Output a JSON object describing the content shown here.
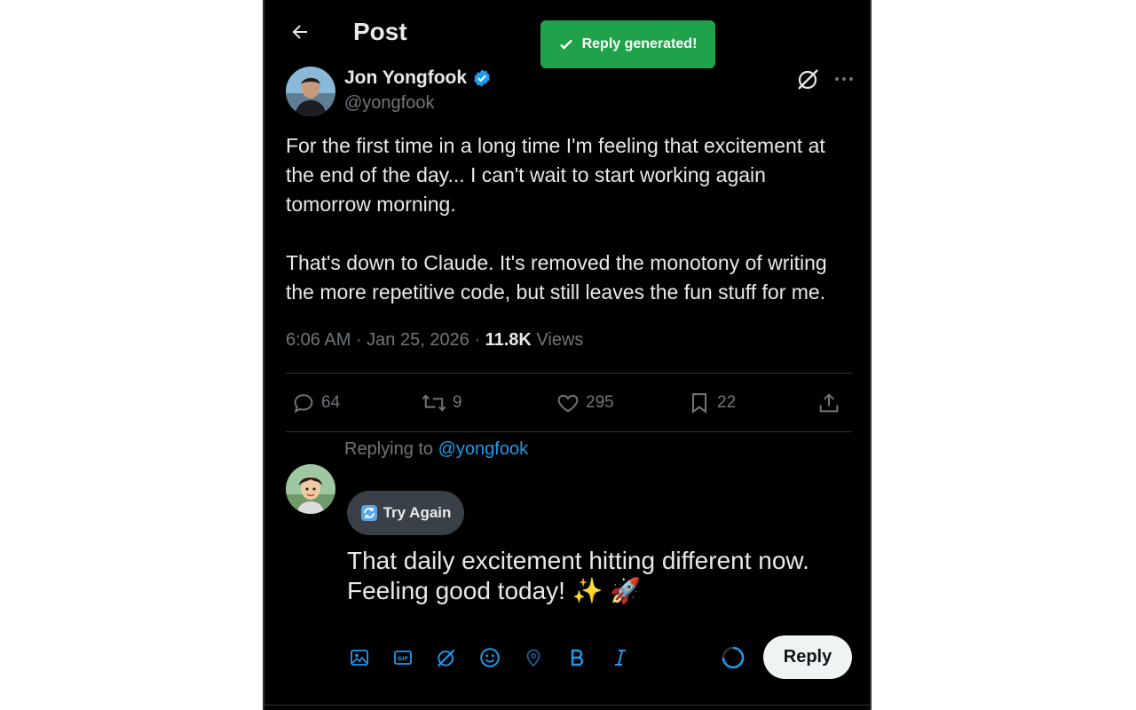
{
  "header": {
    "title": "Post",
    "back_icon": "arrow-left-icon"
  },
  "toast": {
    "text": "Reply generated!",
    "color": "#1fa24a",
    "icon": "checkmark-icon"
  },
  "post": {
    "author_name": "Jon Yongfook",
    "author_handle": "@yongfook",
    "verified": true,
    "paragraphs": [
      "For the first time in a long time I'm feeling that excitement at the end of the day... I can't wait to start working again tomorrow morning.",
      "That's down to Claude. It's removed the monotony of writing the more repetitive code, but still leaves the fun stuff for me."
    ],
    "timestamp": "6:06 AM · Jan 25, 2026 · ",
    "views_count": "11.8K",
    "views_label": "Views",
    "stats": {
      "replies": "64",
      "reposts": "9",
      "likes": "295",
      "bookmarks": "22"
    }
  },
  "reply": {
    "replying_to_label": "Replying to",
    "replying_to_handle": "@yongfook",
    "try_again_label": "Try Again",
    "text_line1": "That daily excitement hitting different now.",
    "text_line2": "Feeling good today! ✨ 🚀",
    "submit_label": "Reply"
  },
  "colors": {
    "accent": "#1d9bf0",
    "background": "#000000",
    "text": "#e7e9ea",
    "muted": "#71767b"
  }
}
